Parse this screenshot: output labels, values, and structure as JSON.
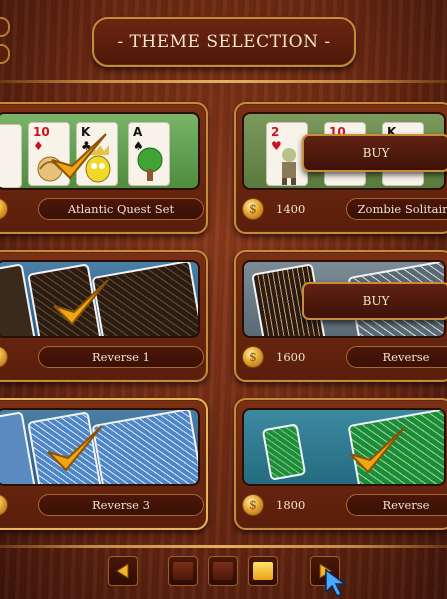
{
  "header": {
    "title": "- THEME SELECTION -"
  },
  "themes": [
    {
      "name": "Atlantic Quest Set",
      "price": "",
      "selected": true,
      "owned": true
    },
    {
      "name": "Zombie Solitaire",
      "price": "1400",
      "buy_label": "BUY",
      "owned": false
    },
    {
      "name": "Reverse 1",
      "price": "",
      "selected": true,
      "owned": true
    },
    {
      "name": "Reverse",
      "price": "1600",
      "buy_label": "BUY",
      "owned": false
    },
    {
      "name": "Reverse 3",
      "price": "",
      "selected": true,
      "owned": true
    },
    {
      "name": "Reverse",
      "price": "1800",
      "owned": false,
      "selected": true
    }
  ],
  "cards_atlantic": [
    {
      "rank": "10",
      "suit": "♦",
      "color": "#c8141e"
    },
    {
      "rank": "K",
      "suit": "♣",
      "color": "#111111"
    },
    {
      "rank": "A",
      "suit": "♠",
      "color": "#111111"
    }
  ],
  "cards_zombie": [
    {
      "rank": "2",
      "suit": "♥",
      "color": "#c8141e"
    },
    {
      "rank": "10",
      "suit": "♦",
      "color": "#c8141e"
    },
    {
      "rank": "K",
      "suit": "♣",
      "color": "#111111"
    }
  ],
  "pagination": {
    "pages": 3,
    "current_page": 3
  },
  "icons": {
    "prev": "arrow-left-icon",
    "next": "arrow-right-icon",
    "coin": "coin-icon",
    "check": "checkmark-icon",
    "cursor": "mouse-cursor-icon"
  },
  "colors": {
    "accent_gold": "#e2b15e",
    "wood": "#6a2812",
    "check": "#f0a515"
  }
}
